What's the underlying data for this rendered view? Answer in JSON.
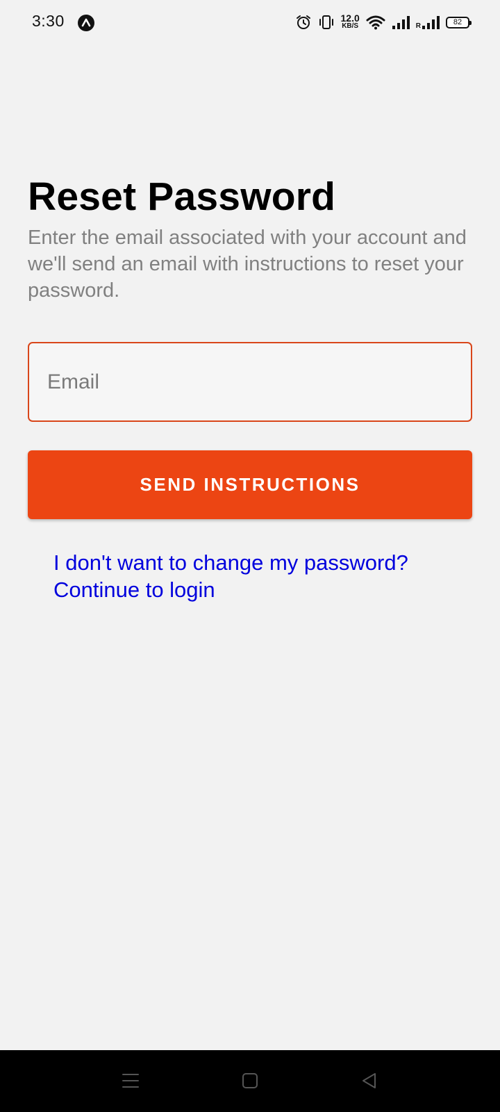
{
  "status_bar": {
    "time": "3:30",
    "net_speed_value": "12.0",
    "net_speed_unit": "KB/S",
    "roaming_label": "R",
    "battery": "82"
  },
  "screen": {
    "title": "Reset Password",
    "subtitle": "Enter the email associated with your account and we'll send an email with instructions to reset your password.",
    "email_field": {
      "value": "",
      "placeholder": "Email"
    },
    "send_button_label": "SEND INSTRUCTIONS",
    "login_link_line1": "I don't want to change my password?",
    "login_link_line2": "Continue to login"
  },
  "nav_bar": {
    "buttons": [
      "menu-icon",
      "home-square-icon",
      "back-triangle-icon"
    ]
  },
  "colors": {
    "accent": "#ec4513",
    "field_border": "#d9461a",
    "link": "#0000dd",
    "background": "#f2f2f2",
    "subtitle_text": "#808080"
  }
}
